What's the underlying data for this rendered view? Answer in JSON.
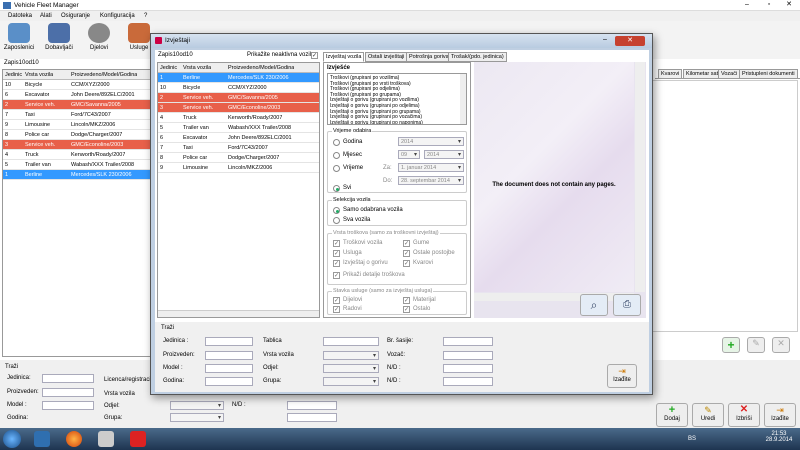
{
  "main_window": {
    "title": "Vehicle Fleet Manager",
    "menu": [
      "Datoteka",
      "Alati",
      "Osiguranje",
      "Konfiguracija",
      "?"
    ],
    "toolbar": [
      "Zaposlenici",
      "Dobavljači",
      "Djelovi",
      "Usluge"
    ],
    "record_count": "Zapis10od10",
    "columns": [
      "Jedinic",
      "Vrsta vozila",
      "Proizvedeno/Model/Godina"
    ],
    "rows": [
      {
        "id": "10",
        "type": "Bicycle",
        "model": "CCM/XYZ/2000",
        "style": ""
      },
      {
        "id": "6",
        "type": "Excavator",
        "model": "John Deere/892ELC/2001",
        "style": ""
      },
      {
        "id": "2",
        "type": "Service veh.",
        "model": "GMC/Savanna/2005",
        "style": "red"
      },
      {
        "id": "7",
        "type": "Taxi",
        "model": "Ford/7C43/2007",
        "style": ""
      },
      {
        "id": "9",
        "type": "Limousine",
        "model": "Lincoln/MKZ/2006",
        "style": ""
      },
      {
        "id": "8",
        "type": "Police car",
        "model": "Dodge/Charger/2007",
        "style": ""
      },
      {
        "id": "3",
        "type": "Service veh.",
        "model": "GMC/Econoline/2003",
        "style": "red"
      },
      {
        "id": "4",
        "type": "Truck",
        "model": "Kenworth/Roady/2007",
        "style": ""
      },
      {
        "id": "5",
        "type": "Trailer van",
        "model": "Wabash/XXX Trailer/2008",
        "style": ""
      },
      {
        "id": "1",
        "type": "Berline",
        "model": "Mercedes/SLK 230/2006",
        "style": "blue"
      }
    ],
    "right_tabs": [
      "Kvarovi",
      "Kilometar sat",
      "Vozači",
      "Pristupleni dokumenti"
    ],
    "search": {
      "title": "Traži",
      "jedinica": "Jedinica:",
      "proizveden": "Proizveden:",
      "model": "Model :",
      "godina": "Godina:",
      "licenca": "Licenca/registracija",
      "vrsta": "Vrsta vozila",
      "odjel": "Odjel:",
      "grupa": "Grupa:",
      "nd": "N/D :"
    },
    "buttons": {
      "dodaj": "Dodaj",
      "uredi": "Uredi",
      "izbrisi": "Izbriši",
      "izadite": "Izađite"
    }
  },
  "dialog": {
    "title": "Izvještaji",
    "record_count": "Zapis10od10",
    "show_inactive": "Prikažite neaktivna vozila",
    "columns": [
      "Jedinic",
      "Vrsta vozila",
      "Proizvedeno/Model/Godina"
    ],
    "rows": [
      {
        "id": "1",
        "type": "Berline",
        "model": "Mercedes/SLK 230/2006",
        "style": "blue"
      },
      {
        "id": "10",
        "type": "Bicycle",
        "model": "CCM/XYZ/2000",
        "style": ""
      },
      {
        "id": "2",
        "type": "Service veh.",
        "model": "GMC/Savanna/2005",
        "style": "red"
      },
      {
        "id": "3",
        "type": "Service veh.",
        "model": "GMC/Econoline/2003",
        "style": "red"
      },
      {
        "id": "4",
        "type": "Truck",
        "model": "Kenworth/Roady/2007",
        "style": ""
      },
      {
        "id": "5",
        "type": "Trailer van",
        "model": "Wabash/XXX Trailer/2008",
        "style": ""
      },
      {
        "id": "6",
        "type": "Excavator",
        "model": "John Deere/892ELC/2001",
        "style": ""
      },
      {
        "id": "7",
        "type": "Taxi",
        "model": "Ford/7C43/2007",
        "style": ""
      },
      {
        "id": "8",
        "type": "Police car",
        "model": "Dodge/Charger/2007",
        "style": ""
      },
      {
        "id": "9",
        "type": "Limousine",
        "model": "Lincoln/MKZ/2006",
        "style": ""
      }
    ],
    "tabs": [
      "Izvještaj vozila",
      "Ostali izvještaji",
      "Potrošnja goriva",
      "Trošak/(pdo. jedinica)"
    ],
    "reports_label": "Izvješće",
    "reports": [
      "Troškovi (grupirani po vozilima)",
      "Troškovi (grupirani po vrsti troškova)",
      "Troškovi (grupirani po odjelima)",
      "Troškovi (grupirani po grupama)",
      "Izvještaji o gorivu (grupirani po vozilima)",
      "Izvještaji o gorivu (grupirani po odjelima)",
      "Izvještaji o gorivu (grupirani po grupama)",
      "Izvještaji o gorivu (grupirani po vozačima)",
      "Izvještaji o gorivu (grupirani po naponima)"
    ],
    "period": {
      "title": "Vrijeme odabira",
      "godina": "Godina",
      "godina_val": "2014",
      "mjesec": "Mjesec",
      "mjesec_val": "09",
      "mjesec_year": "2014",
      "vrijeme": "Vrijeme",
      "za": "Za:",
      "za_val": "1.  januar  2014",
      "do": "Do:",
      "do_val": "28. septembar 2014",
      "svi": "Svi"
    },
    "vehicle_sel": {
      "title": "Selekcija vozila",
      "samo": "Samo odabrana vozila",
      "sva": "Sva vozila"
    },
    "cost_types": {
      "title": "Vrsta troškova (samo za troškovni izvještaj)",
      "items": [
        "Troškovi vozila",
        "Gume",
        "Usluga",
        "Ostale postojbe",
        "Izvještaj o gorivu",
        "Kvarovi"
      ],
      "details": "Prikaži detalje troškova"
    },
    "service_types": {
      "title": "Stavka usluge (samo za izvještaj usluga)",
      "items": [
        "Dijelovi",
        "Materijal",
        "Radovi",
        "Ostalo"
      ]
    },
    "preview_msg": "The document does not contain any pages.",
    "search": {
      "title": "Traži",
      "jedinica": "Jedinica :",
      "proizveden": "Proizveden:",
      "model": "Model :",
      "godina": "Godina:",
      "tablica": "Tablica",
      "vrsta": "Vrsta vozila",
      "odjel": "Odjel:",
      "grupa": "Grupa:",
      "br_sasije": "Br. šasije:",
      "vozac": "Vozač:",
      "nd": "N/D :"
    },
    "exit": "Izađite"
  },
  "taskbar": {
    "lang": "BS",
    "time": "21:53",
    "date": "28.9.2014"
  }
}
